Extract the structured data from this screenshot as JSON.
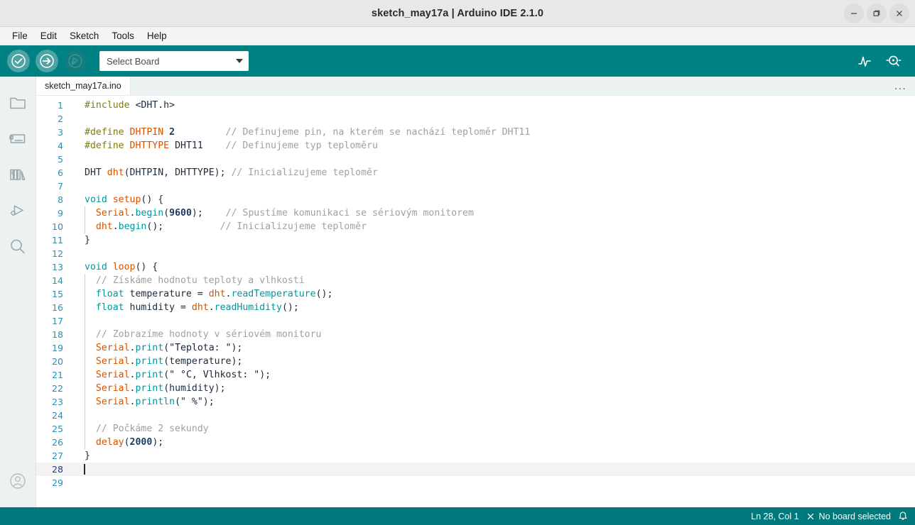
{
  "window": {
    "title": "sketch_may17a | Arduino IDE 2.1.0",
    "controls": [
      {
        "name": "minimize-button",
        "glyph": "minimize-icon"
      },
      {
        "name": "maximize-button",
        "glyph": "maximize-icon"
      },
      {
        "name": "close-button",
        "glyph": "close-icon"
      }
    ]
  },
  "menubar": {
    "items": [
      {
        "label": "File"
      },
      {
        "label": "Edit"
      },
      {
        "label": "Sketch"
      },
      {
        "label": "Tools"
      },
      {
        "label": "Help"
      }
    ]
  },
  "toolbar": {
    "verify_label": "Verify",
    "upload_label": "Upload",
    "debug_label": "Debug",
    "board_selector": {
      "value": "Select Board",
      "placeholder": "Select Board"
    },
    "serial_plotter_label": "Serial Plotter",
    "serial_monitor_label": "Serial Monitor",
    "background": "#008184"
  },
  "sidebar": {
    "items": [
      {
        "icon": "folder-icon",
        "label": "Sketchbook"
      },
      {
        "icon": "boards-manager-icon",
        "label": "Boards Manager"
      },
      {
        "icon": "library-manager-icon",
        "label": "Library Manager"
      },
      {
        "icon": "debug-icon",
        "label": "Debug"
      },
      {
        "icon": "search-icon",
        "label": "Search"
      }
    ],
    "account": {
      "icon": "account-icon",
      "label": "Account"
    }
  },
  "editor": {
    "tabs": [
      {
        "label": "sketch_may17a.ino",
        "active": true
      }
    ],
    "overflow_label": "...",
    "active_line": 28,
    "total_lines": 29,
    "lines": [
      {
        "n": 1,
        "tokens": [
          {
            "c": "t-pre",
            "t": "#include"
          },
          {
            "c": "t-plain",
            "t": " "
          },
          {
            "c": "t-inc",
            "t": "<DHT.h>"
          }
        ]
      },
      {
        "n": 2,
        "tokens": []
      },
      {
        "n": 3,
        "tokens": [
          {
            "c": "t-pre",
            "t": "#define"
          },
          {
            "c": "t-plain",
            "t": " "
          },
          {
            "c": "t-fn",
            "t": "DHTPIN"
          },
          {
            "c": "t-plain",
            "t": " "
          },
          {
            "c": "t-num",
            "t": "2"
          },
          {
            "c": "t-plain",
            "t": "         "
          },
          {
            "c": "t-cmt",
            "t": "// Definujeme pin, na kterém se nachází teploměr DHT11"
          }
        ]
      },
      {
        "n": 4,
        "tokens": [
          {
            "c": "t-pre",
            "t": "#define"
          },
          {
            "c": "t-plain",
            "t": " "
          },
          {
            "c": "t-fn",
            "t": "DHTTYPE"
          },
          {
            "c": "t-plain",
            "t": " "
          },
          {
            "c": "t-plain",
            "t": "DHT11"
          },
          {
            "c": "t-plain",
            "t": "    "
          },
          {
            "c": "t-cmt",
            "t": "// Definujeme typ teploměru"
          }
        ]
      },
      {
        "n": 5,
        "tokens": []
      },
      {
        "n": 6,
        "tokens": [
          {
            "c": "t-plain",
            "t": "DHT "
          },
          {
            "c": "t-fn",
            "t": "dht"
          },
          {
            "c": "t-punc",
            "t": "("
          },
          {
            "c": "t-plain",
            "t": "DHTPIN, DHTTYPE"
          },
          {
            "c": "t-punc",
            "t": "); "
          },
          {
            "c": "t-cmt",
            "t": "// Inicializujeme teploměr"
          }
        ]
      },
      {
        "n": 7,
        "tokens": []
      },
      {
        "n": 8,
        "tokens": [
          {
            "c": "t-kw",
            "t": "void"
          },
          {
            "c": "t-plain",
            "t": " "
          },
          {
            "c": "t-fn",
            "t": "setup"
          },
          {
            "c": "t-punc",
            "t": "() {"
          }
        ]
      },
      {
        "n": 9,
        "indent": true,
        "tokens": [
          {
            "c": "t-plain",
            "t": "  "
          },
          {
            "c": "t-fn",
            "t": "Serial"
          },
          {
            "c": "t-punc",
            "t": "."
          },
          {
            "c": "t-meth",
            "t": "begin"
          },
          {
            "c": "t-punc",
            "t": "("
          },
          {
            "c": "t-num",
            "t": "9600"
          },
          {
            "c": "t-punc",
            "t": ");"
          },
          {
            "c": "t-plain",
            "t": "    "
          },
          {
            "c": "t-cmt",
            "t": "// Spustíme komunikaci se sériovým monitorem"
          }
        ]
      },
      {
        "n": 10,
        "indent": true,
        "tokens": [
          {
            "c": "t-plain",
            "t": "  "
          },
          {
            "c": "t-fn",
            "t": "dht"
          },
          {
            "c": "t-punc",
            "t": "."
          },
          {
            "c": "t-meth",
            "t": "begin"
          },
          {
            "c": "t-punc",
            "t": "();"
          },
          {
            "c": "t-plain",
            "t": "          "
          },
          {
            "c": "t-cmt",
            "t": "// Inicializujeme teploměr"
          }
        ]
      },
      {
        "n": 11,
        "tokens": [
          {
            "c": "t-punc",
            "t": "}"
          }
        ]
      },
      {
        "n": 12,
        "tokens": []
      },
      {
        "n": 13,
        "tokens": [
          {
            "c": "t-kw",
            "t": "void"
          },
          {
            "c": "t-plain",
            "t": " "
          },
          {
            "c": "t-fn",
            "t": "loop"
          },
          {
            "c": "t-punc",
            "t": "() {"
          }
        ]
      },
      {
        "n": 14,
        "indent": true,
        "tokens": [
          {
            "c": "t-plain",
            "t": "  "
          },
          {
            "c": "t-cmt",
            "t": "// Získáme hodnotu teploty a vlhkosti"
          }
        ]
      },
      {
        "n": 15,
        "indent": true,
        "tokens": [
          {
            "c": "t-plain",
            "t": "  "
          },
          {
            "c": "t-kw",
            "t": "float"
          },
          {
            "c": "t-plain",
            "t": " temperature = "
          },
          {
            "c": "t-fn",
            "t": "dht"
          },
          {
            "c": "t-punc",
            "t": "."
          },
          {
            "c": "t-meth",
            "t": "readTemperature"
          },
          {
            "c": "t-punc",
            "t": "();"
          }
        ]
      },
      {
        "n": 16,
        "indent": true,
        "tokens": [
          {
            "c": "t-plain",
            "t": "  "
          },
          {
            "c": "t-kw",
            "t": "float"
          },
          {
            "c": "t-plain",
            "t": " humidity = "
          },
          {
            "c": "t-fn",
            "t": "dht"
          },
          {
            "c": "t-punc",
            "t": "."
          },
          {
            "c": "t-meth",
            "t": "readHumidity"
          },
          {
            "c": "t-punc",
            "t": "();"
          }
        ]
      },
      {
        "n": 17,
        "indent": true,
        "tokens": []
      },
      {
        "n": 18,
        "indent": true,
        "tokens": [
          {
            "c": "t-plain",
            "t": "  "
          },
          {
            "c": "t-cmt",
            "t": "// Zobrazíme hodnoty v sériovém monitoru"
          }
        ]
      },
      {
        "n": 19,
        "indent": true,
        "tokens": [
          {
            "c": "t-plain",
            "t": "  "
          },
          {
            "c": "t-fn",
            "t": "Serial"
          },
          {
            "c": "t-punc",
            "t": "."
          },
          {
            "c": "t-meth",
            "t": "print"
          },
          {
            "c": "t-punc",
            "t": "("
          },
          {
            "c": "t-str",
            "t": "\"Teplota: \""
          },
          {
            "c": "t-punc",
            "t": ");"
          }
        ]
      },
      {
        "n": 20,
        "indent": true,
        "tokens": [
          {
            "c": "t-plain",
            "t": "  "
          },
          {
            "c": "t-fn",
            "t": "Serial"
          },
          {
            "c": "t-punc",
            "t": "."
          },
          {
            "c": "t-meth",
            "t": "print"
          },
          {
            "c": "t-punc",
            "t": "("
          },
          {
            "c": "t-plain",
            "t": "temperature"
          },
          {
            "c": "t-punc",
            "t": ");"
          }
        ]
      },
      {
        "n": 21,
        "indent": true,
        "tokens": [
          {
            "c": "t-plain",
            "t": "  "
          },
          {
            "c": "t-fn",
            "t": "Serial"
          },
          {
            "c": "t-punc",
            "t": "."
          },
          {
            "c": "t-meth",
            "t": "print"
          },
          {
            "c": "t-punc",
            "t": "("
          },
          {
            "c": "t-str",
            "t": "\" °C, Vlhkost: \""
          },
          {
            "c": "t-punc",
            "t": ");"
          }
        ]
      },
      {
        "n": 22,
        "indent": true,
        "tokens": [
          {
            "c": "t-plain",
            "t": "  "
          },
          {
            "c": "t-fn",
            "t": "Serial"
          },
          {
            "c": "t-punc",
            "t": "."
          },
          {
            "c": "t-meth",
            "t": "print"
          },
          {
            "c": "t-punc",
            "t": "("
          },
          {
            "c": "t-plain",
            "t": "humidity"
          },
          {
            "c": "t-punc",
            "t": ");"
          }
        ]
      },
      {
        "n": 23,
        "indent": true,
        "tokens": [
          {
            "c": "t-plain",
            "t": "  "
          },
          {
            "c": "t-fn",
            "t": "Serial"
          },
          {
            "c": "t-punc",
            "t": "."
          },
          {
            "c": "t-meth",
            "t": "println"
          },
          {
            "c": "t-punc",
            "t": "("
          },
          {
            "c": "t-str",
            "t": "\" %\""
          },
          {
            "c": "t-punc",
            "t": ");"
          }
        ]
      },
      {
        "n": 24,
        "indent": true,
        "tokens": []
      },
      {
        "n": 25,
        "indent": true,
        "tokens": [
          {
            "c": "t-plain",
            "t": "  "
          },
          {
            "c": "t-cmt",
            "t": "// Počkáme 2 sekundy"
          }
        ]
      },
      {
        "n": 26,
        "indent": true,
        "tokens": [
          {
            "c": "t-plain",
            "t": "  "
          },
          {
            "c": "t-fn",
            "t": "delay"
          },
          {
            "c": "t-punc",
            "t": "("
          },
          {
            "c": "t-num",
            "t": "2000"
          },
          {
            "c": "t-punc",
            "t": ");"
          }
        ]
      },
      {
        "n": 27,
        "tokens": [
          {
            "c": "t-punc",
            "t": "}"
          }
        ]
      },
      {
        "n": 28,
        "active": true,
        "cursor": true,
        "tokens": []
      },
      {
        "n": 29,
        "tokens": []
      }
    ]
  },
  "statusbar": {
    "cursor_position": "Ln 28, Col 1",
    "board_status": "No board selected",
    "board_status_icon": "close-x-icon",
    "notifications_icon": "bell-icon",
    "background": "#00797c"
  }
}
